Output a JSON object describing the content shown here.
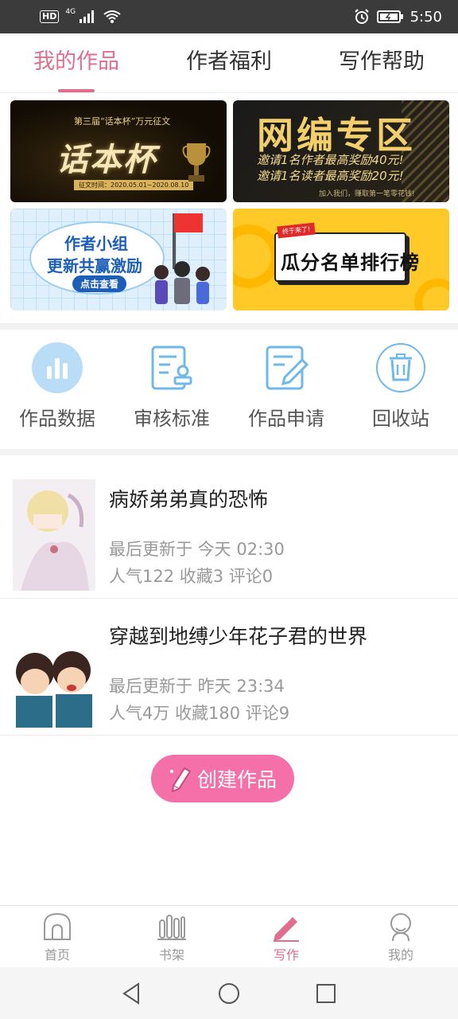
{
  "status_bar": {
    "hd": "HD",
    "network": "4G",
    "time": "5:50"
  },
  "top_tabs": [
    {
      "label": "我的作品",
      "active": true
    },
    {
      "label": "作者福利",
      "active": false
    },
    {
      "label": "写作帮助",
      "active": false
    }
  ],
  "banners": {
    "b1": {
      "subtitle": "第三届“话本杯”万元征文",
      "title": "话本杯",
      "date": "征文时间：2020.05.01~2020.08.10"
    },
    "b2": {
      "title": "网编专区",
      "line1": "邀请1名作者最高奖励40元!",
      "line2": "邀请1名读者最高奖励20元!",
      "footer": "加入我们，赚取第一笔零花钱!"
    },
    "b3": {
      "line1": "作者小组",
      "line2": "更新共赢激励",
      "button": "点击查看"
    },
    "b4": {
      "tag": "终于来了!",
      "title": "瓜分名单排行榜"
    }
  },
  "quick_actions": [
    {
      "label": "作品数据",
      "icon": "bar-chart-icon"
    },
    {
      "label": "审核标准",
      "icon": "review-doc-icon"
    },
    {
      "label": "作品申请",
      "icon": "edit-doc-icon"
    },
    {
      "label": "回收站",
      "icon": "trash-icon"
    }
  ],
  "works": [
    {
      "title": "病娇弟弟真的恐怖",
      "updated": "最后更新于 今天 02:30",
      "stats": "人气122 收藏3 评论0"
    },
    {
      "title": "穿越到地缚少年花子君的世界",
      "updated": "最后更新于 昨天 23:34",
      "stats": "人气4万 收藏180 评论9"
    }
  ],
  "create_button": "创建作品",
  "bottom_nav": [
    {
      "label": "首页",
      "icon": "home-icon",
      "active": false
    },
    {
      "label": "书架",
      "icon": "bookshelf-icon",
      "active": false
    },
    {
      "label": "写作",
      "icon": "pen-icon",
      "active": true
    },
    {
      "label": "我的",
      "icon": "profile-icon",
      "active": false
    }
  ],
  "colors": {
    "accent": "#e06e8e",
    "create_button": "#f56fa8",
    "icon_blue": "#6fb8ea"
  }
}
